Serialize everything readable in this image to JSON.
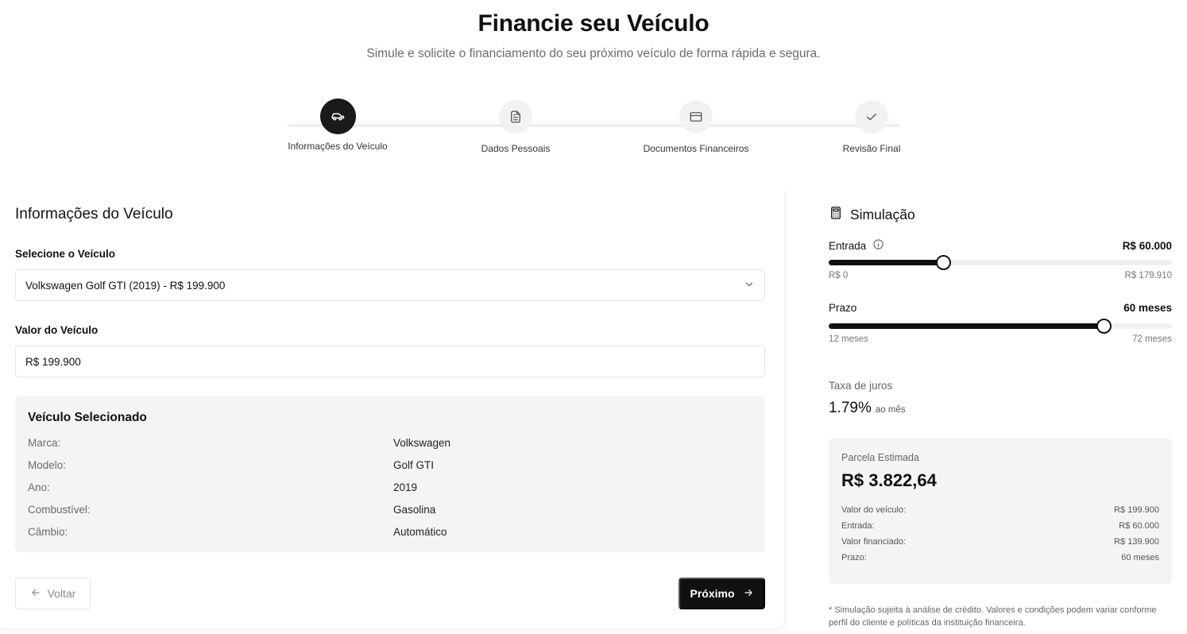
{
  "header": {
    "title": "Financie seu Veículo",
    "subtitle": "Simule e solicite o financiamento do seu próximo veículo de forma rápida e segura."
  },
  "stepper": {
    "steps": [
      {
        "label": "Informações do Veículo",
        "icon": "car-icon",
        "active": true
      },
      {
        "label": "Dados Pessoais",
        "icon": "document-icon",
        "active": false
      },
      {
        "label": "Documentos Financeiros",
        "icon": "credit-card-icon",
        "active": false
      },
      {
        "label": "Revisão Final",
        "icon": "check-icon",
        "active": false
      }
    ]
  },
  "form": {
    "title": "Informações do Veículo",
    "select_label": "Selecione o Veículo",
    "select_value": "Volkswagen Golf GTI (2019) - R$ 199.900",
    "value_label": "Valor do Veículo",
    "value_input": "R$ 199.900"
  },
  "vehicle": {
    "title": "Veículo Selecionado",
    "rows": [
      {
        "key": "Marca:",
        "value": "Volkswagen"
      },
      {
        "key": "Modelo:",
        "value": "Golf GTI"
      },
      {
        "key": "Ano:",
        "value": "2019"
      },
      {
        "key": "Combustível:",
        "value": "Gasolina"
      },
      {
        "key": "Câmbio:",
        "value": "Automático"
      }
    ]
  },
  "actions": {
    "back_label": "Voltar",
    "next_label": "Próximo"
  },
  "simulation": {
    "title": "Simulação",
    "entrada": {
      "label": "Entrada",
      "value": "R$ 60.000",
      "min": "R$ 0",
      "max": "R$ 179.910",
      "fraction": 0.3335
    },
    "prazo": {
      "label": "Prazo",
      "value": "60 meses",
      "min": "12 meses",
      "max": "72 meses",
      "fraction": 0.8
    },
    "rate_label": "Taxa de juros",
    "rate_value": "1.79%",
    "rate_unit": "ao mês",
    "parcela_label": "Parcela Estimada",
    "parcela_value": "R$ 3.822,64",
    "summary": [
      {
        "key": "Valor do veículo:",
        "value": "R$ 199.900"
      },
      {
        "key": "Entrada:",
        "value": "R$ 60.000"
      },
      {
        "key": "Valor financiado:",
        "value": "R$ 139.900"
      },
      {
        "key": "Prazo:",
        "value": "60 meses"
      }
    ],
    "disclaimer": "* Simulação sujeita à análise de crédito. Valores e condições podem variar conforme perfil do cliente e políticas da instituição financeira."
  },
  "colors": {
    "primary": "#111111",
    "muted": "#6b6b6b",
    "card_bg": "#f4f4f4",
    "border": "#e3e3e3"
  }
}
